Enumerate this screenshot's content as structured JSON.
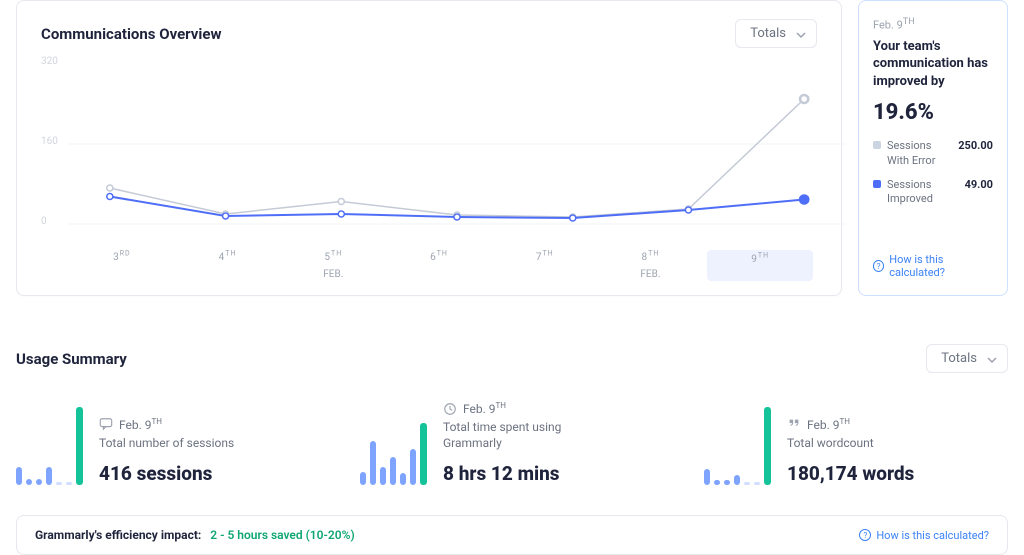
{
  "overview": {
    "title": "Communications Overview",
    "selector_label": "Totals"
  },
  "chart_data": {
    "type": "line",
    "title": "Communications Overview",
    "xlabel": "",
    "ylabel": "",
    "y_ticks": [
      0,
      160,
      320
    ],
    "ylim": [
      0,
      320
    ],
    "x_ticks": [
      {
        "day": "3",
        "ord": "RD",
        "month": ""
      },
      {
        "day": "4",
        "ord": "TH",
        "month": ""
      },
      {
        "day": "5",
        "ord": "TH",
        "month": "FEB."
      },
      {
        "day": "6",
        "ord": "TH",
        "month": ""
      },
      {
        "day": "7",
        "ord": "TH",
        "month": ""
      },
      {
        "day": "8",
        "ord": "TH",
        "month": "FEB."
      },
      {
        "day": "9",
        "ord": "TH",
        "month": ""
      }
    ],
    "selected_x_index": 6,
    "series": [
      {
        "name": "Sessions With Error",
        "color": "#c4cad6",
        "values": [
          72,
          20,
          45,
          18,
          14,
          30,
          250
        ]
      },
      {
        "name": "Sessions Improved",
        "color": "#4f6ef7",
        "values": [
          55,
          16,
          20,
          14,
          12,
          28,
          49
        ],
        "highlight_last": true
      }
    ]
  },
  "side": {
    "date_prefix": "Feb. 9",
    "date_ord": "TH",
    "lead": "Your team's communication has improved by",
    "big_value": "19.6%",
    "rows": [
      {
        "color": "grey",
        "label": "Sessions With Error",
        "value": "250.00"
      },
      {
        "color": "blue",
        "label": "Sessions Improved",
        "value": "49.00"
      }
    ],
    "link": "How is this calculated?"
  },
  "usage": {
    "title": "Usage Summary",
    "selector_label": "Totals",
    "cards": [
      {
        "icon": "chat",
        "date_prefix": "Feb. 9",
        "date_ord": "TH",
        "desc": "Total number of sessions",
        "value": "416 sessions",
        "bars": [
          18,
          6,
          6,
          18,
          0,
          0,
          78
        ]
      },
      {
        "icon": "clock",
        "date_prefix": "Feb. 9",
        "date_ord": "TH",
        "desc": "Total time spent using Grammarly",
        "value": "8 hrs 12 mins",
        "bars": [
          13,
          44,
          18,
          28,
          12,
          36,
          62
        ]
      },
      {
        "icon": "quote",
        "date_prefix": "Feb. 9",
        "date_ord": "TH",
        "desc": "Total wordcount",
        "value": "180,174 words",
        "bars": [
          16,
          5,
          5,
          10,
          0,
          0,
          78
        ]
      }
    ]
  },
  "impact": {
    "label": "Grammarly's efficiency impact:",
    "value": "2 - 5 hours saved (10-20%)",
    "link": "How is this calculated?"
  }
}
